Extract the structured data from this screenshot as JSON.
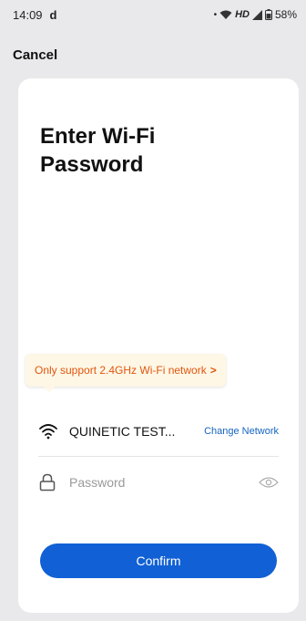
{
  "status_bar": {
    "time": "14:09",
    "left_icon_glyph": "d",
    "network_label": "HD",
    "battery": "58%"
  },
  "nav": {
    "cancel_label": "Cancel"
  },
  "page": {
    "title": "Enter Wi-Fi Password",
    "tooltip_text": "Only support 2.4GHz Wi-Fi network",
    "tooltip_chevron": ">"
  },
  "network": {
    "ssid": "QUINETIC TEST...",
    "change_label": "Change Network"
  },
  "password": {
    "placeholder": "Password",
    "value": ""
  },
  "confirm_label": "Confirm",
  "colors": {
    "accent": "#1160d5",
    "link": "#1565c0",
    "warning": "#e0560f",
    "tooltip_bg": "#fff7e6"
  }
}
